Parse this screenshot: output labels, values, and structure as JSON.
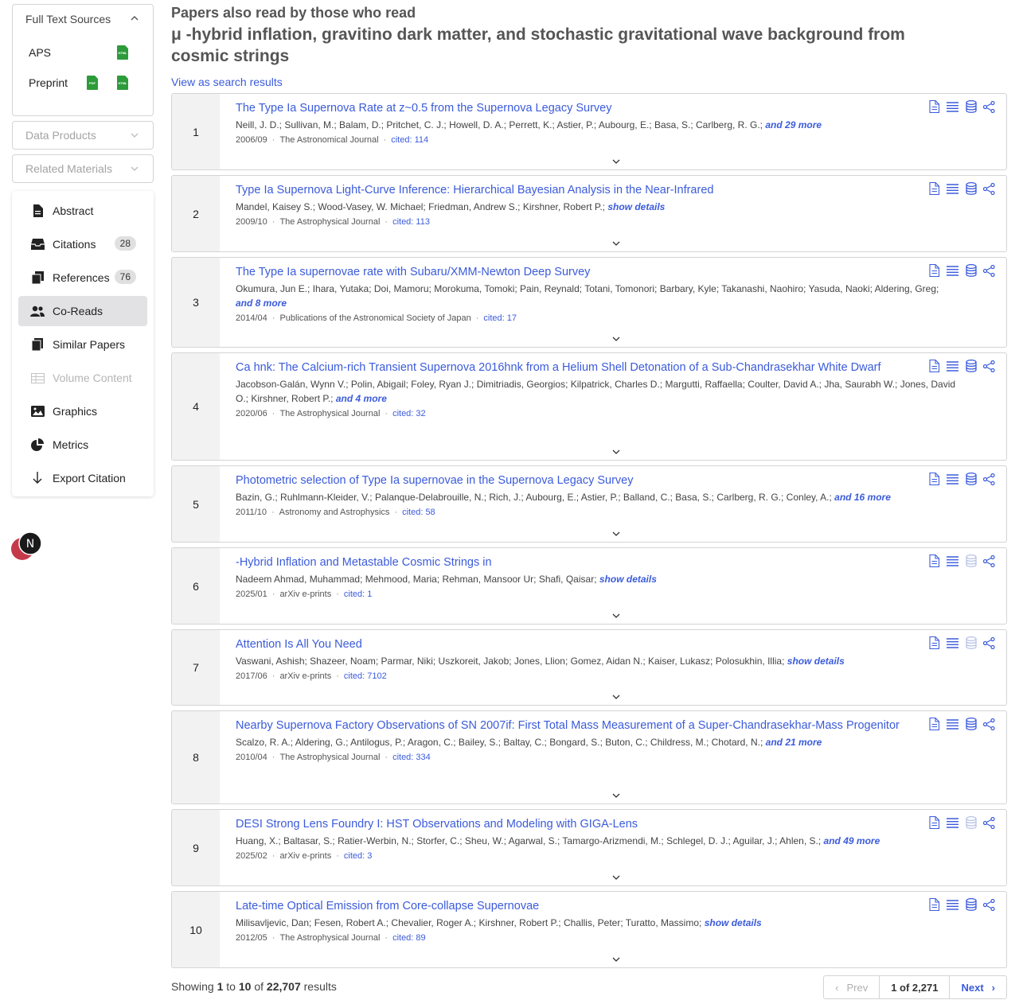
{
  "sidebar": {
    "full_text_sources": {
      "heading": "Full Text Sources",
      "items": [
        {
          "label": "APS",
          "files": [
            "HTML"
          ]
        },
        {
          "label": "Preprint",
          "files": [
            "PDF",
            "HTML"
          ]
        }
      ]
    },
    "data_products": "Data Products",
    "related_materials": "Related Materials",
    "nav": [
      {
        "label": "Abstract",
        "icon": "document-icon"
      },
      {
        "label": "Citations",
        "icon": "inbox-icon",
        "badge": "28"
      },
      {
        "label": "References",
        "icon": "copy-icon",
        "badge": "76"
      },
      {
        "label": "Co-Reads",
        "icon": "users-icon",
        "active": true
      },
      {
        "label": "Similar Papers",
        "icon": "pages-icon"
      },
      {
        "label": "Volume Content",
        "icon": "table-icon",
        "disabled": true
      },
      {
        "label": "Graphics",
        "icon": "image-icon"
      },
      {
        "label": "Metrics",
        "icon": "pie-chart-icon"
      },
      {
        "label": "Export Citation",
        "icon": "download-icon"
      }
    ]
  },
  "header": {
    "subtitle": "Papers also read by those who read",
    "title": "μ -hybrid inflation, gravitino dark matter, and stochastic gravitational wave background from cosmic strings",
    "view_link": "View as search results"
  },
  "results": [
    {
      "num": "1",
      "title": "The Type Ia Supernova Rate at z~0.5 from the Supernova Legacy Survey",
      "authors": "Neill, J. D.; Sullivan, M.; Balam, D.; Pritchet, C. J.; Howell, D. A.; Perrett, K.; Astier, P.; Aubourg, E.; Basa, S.; Carlberg, R. G.;",
      "more": "and 29 more",
      "date": "2006/09",
      "journal": "The Astronomical Journal",
      "cited": "cited: 114",
      "data_icon_active": true
    },
    {
      "num": "2",
      "title": "Type Ia Supernova Light-Curve Inference: Hierarchical Bayesian Analysis in the Near-Infrared",
      "authors": "Mandel, Kaisey S.; Wood-Vasey, W. Michael; Friedman, Andrew S.; Kirshner, Robert P.;",
      "more": "show details",
      "date": "2009/10",
      "journal": "The Astrophysical Journal",
      "cited": "cited: 113",
      "data_icon_active": true
    },
    {
      "num": "3",
      "title": "The Type Ia supernovae rate with Subaru/XMM-Newton Deep Survey",
      "authors": "Okumura, Jun E.; Ihara, Yutaka; Doi, Mamoru; Morokuma, Tomoki; Pain, Reynald; Totani, Tomonori; Barbary, Kyle; Takanashi, Naohiro; Yasuda, Naoki; Aldering, Greg;",
      "more": "and 8 more",
      "date": "2014/04",
      "journal": "Publications of the Astronomical Society of Japan",
      "cited": "cited: 17",
      "data_icon_active": true
    },
    {
      "num": "4",
      "title": "Ca hnk: The Calcium-rich Transient Supernova 2016hnk from a Helium Shell Detonation of a Sub-Chandrasekhar White Dwarf",
      "authors": "Jacobson-Galán, Wynn V.; Polin, Abigail; Foley, Ryan J.; Dimitriadis, Georgios; Kilpatrick, Charles D.; Margutti, Raffaella; Coulter, David A.; Jha, Saurabh W.; Jones, David O.; Kirshner, Robert P.;",
      "more": "and 4 more",
      "date": "2020/06",
      "journal": "The Astrophysical Journal",
      "cited": "cited: 32",
      "data_icon_active": true
    },
    {
      "num": "5",
      "title": "Photometric selection of Type Ia supernovae in the Supernova Legacy Survey",
      "authors": "Bazin, G.; Ruhlmann-Kleider, V.; Palanque-Delabrouille, N.; Rich, J.; Aubourg, E.; Astier, P.; Balland, C.; Basa, S.; Carlberg, R. G.; Conley, A.;",
      "more": "and 16 more",
      "date": "2011/10",
      "journal": "Astronomy and Astrophysics",
      "cited": "cited: 58",
      "data_icon_active": true
    },
    {
      "num": "6",
      "title": "-Hybrid Inflation and Metastable Cosmic Strings in",
      "authors": "Nadeem Ahmad, Muhammad; Mehmood, Maria; Rehman, Mansoor Ur; Shafi, Qaisar;",
      "more": "show details",
      "date": "2025/01",
      "journal": "arXiv e-prints",
      "cited": "cited: 1",
      "data_icon_active": false
    },
    {
      "num": "7",
      "title": "Attention Is All You Need",
      "authors": "Vaswani, Ashish; Shazeer, Noam; Parmar, Niki; Uszkoreit, Jakob; Jones, Llion; Gomez, Aidan N.; Kaiser, Lukasz; Polosukhin, Illia;",
      "more": "show details",
      "date": "2017/06",
      "journal": "arXiv e-prints",
      "cited": "cited: 7102",
      "data_icon_active": false
    },
    {
      "num": "8",
      "title": "Nearby Supernova Factory Observations of SN 2007if: First Total Mass Measurement of a Super-Chandrasekhar-Mass Progenitor",
      "authors": "Scalzo, R. A.; Aldering, G.; Antilogus, P.; Aragon, C.; Bailey, S.; Baltay, C.; Bongard, S.; Buton, C.; Childress, M.; Chotard, N.;",
      "more": "and 21 more",
      "date": "2010/04",
      "journal": "The Astrophysical Journal",
      "cited": "cited: 334",
      "data_icon_active": true
    },
    {
      "num": "9",
      "title": "DESI Strong Lens Foundry I: HST Observations and Modeling with GIGA-Lens",
      "authors": "Huang, X.; Baltasar, S.; Ratier-Werbin, N.; Storfer, C.; Sheu, W.; Agarwal, S.; Tamargo-Arizmendi, M.; Schlegel, D. J.; Aguilar, J.; Ahlen, S.;",
      "more": "and 49 more",
      "date": "2025/02",
      "journal": "arXiv e-prints",
      "cited": "cited: 3",
      "data_icon_active": false
    },
    {
      "num": "10",
      "title": "Late-time Optical Emission from Core-collapse Supernovae",
      "authors": "Milisavljevic, Dan; Fesen, Robert A.; Chevalier, Roger A.; Kirshner, Robert P.; Challis, Peter; Turatto, Massimo;",
      "more": "show details",
      "date": "2012/05",
      "journal": "The Astrophysical Journal",
      "cited": "cited: 89",
      "data_icon_active": true
    }
  ],
  "footer": {
    "showing_prefix": "Showing",
    "from": "1",
    "to_word": "to",
    "to": "10",
    "of_word": "of",
    "total": "22,707",
    "results_word": "results",
    "prev": "Prev",
    "page": "1 of 2,271",
    "next": "Next"
  },
  "colors": {
    "link": "#3b5bdb",
    "green_file": "#2e9b3a",
    "active_nav": "#e2e2e5"
  }
}
